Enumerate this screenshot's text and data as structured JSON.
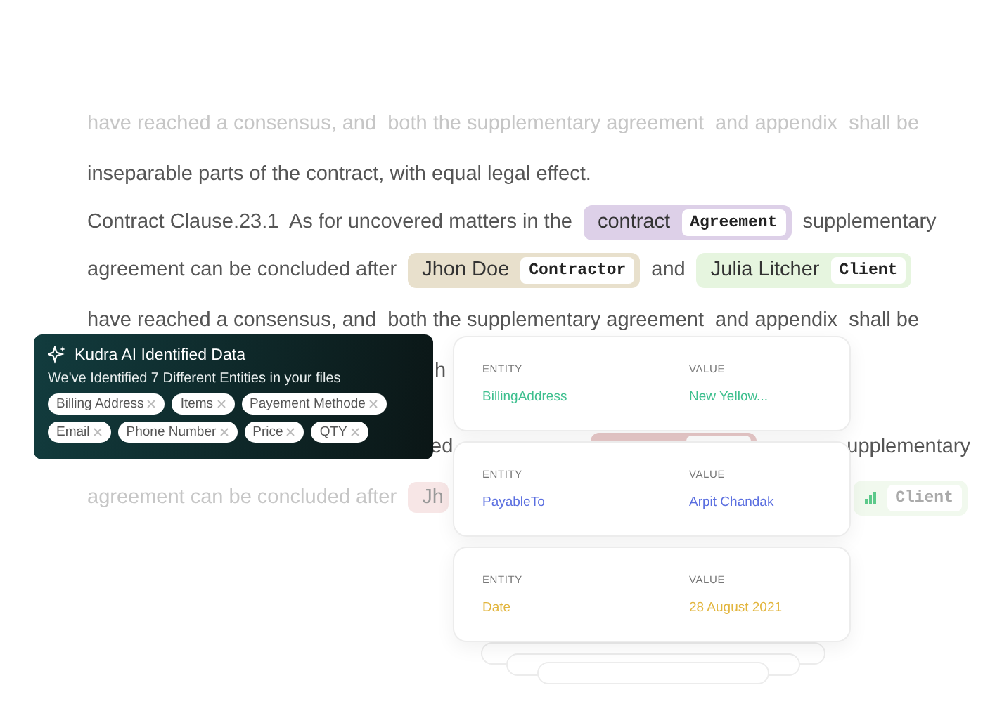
{
  "document": {
    "lines": [
      {
        "faded": true,
        "segments": [
          {
            "kind": "text",
            "text": "have reached a consensus, and"
          },
          {
            "kind": "text",
            "text": "both the supplementary agreement"
          },
          {
            "kind": "text",
            "text": "and appendix"
          },
          {
            "kind": "text",
            "text": "shall be"
          }
        ]
      },
      {
        "faded": false,
        "segments": [
          {
            "kind": "text",
            "text": "inseparable parts of the contract, with equal legal effect."
          }
        ]
      },
      {
        "faded": false,
        "segments": [
          {
            "kind": "text",
            "text": "Contract Clause.23.1  As for uncovered matters in the"
          },
          {
            "kind": "tag",
            "label": "contract",
            "chip": "Agreement",
            "color": "#ddd0e8"
          },
          {
            "kind": "text",
            "text": "supplementary"
          }
        ]
      },
      {
        "faded": false,
        "segments": [
          {
            "kind": "text",
            "text": "agreement can be concluded after"
          },
          {
            "kind": "tag",
            "label": "Jhon Doe",
            "chip": "Contractor",
            "color": "#e8e0cc"
          },
          {
            "kind": "text",
            "text": "and"
          },
          {
            "kind": "tag",
            "label": "Julia Litcher",
            "chip": "Client",
            "color": "#e6f5df"
          }
        ]
      },
      {
        "faded": false,
        "segments": [
          {
            "kind": "text",
            "text": "have reached a consensus, and"
          },
          {
            "kind": "text",
            "text": "both the supplementary agreement"
          },
          {
            "kind": "text",
            "text": "and appendix"
          },
          {
            "kind": "text",
            "text": "shall be"
          }
        ]
      },
      {
        "faded": false,
        "segments": [
          {
            "kind": "text",
            "text": "h"
          }
        ]
      },
      {
        "faded": false,
        "segments": [
          {
            "kind": "text",
            "text": "ed"
          },
          {
            "kind": "tag",
            "color": "#e8c9c9"
          },
          {
            "kind": "text",
            "text": "upplementary"
          }
        ]
      },
      {
        "faded": true,
        "segments": [
          {
            "kind": "text",
            "text": "agreement can be concluded after"
          },
          {
            "kind": "tag",
            "label": "Jh",
            "color": "#f7e6e6"
          },
          {
            "kind": "chart_tag",
            "chip": "Client",
            "color": "#f1f9ee"
          }
        ]
      }
    ]
  },
  "popup": {
    "title": "Kudra AI Identified Data",
    "subtitle": "We've Identified 7 Different Entities in your files",
    "chips": [
      "Billing Address",
      "Items",
      "Payement Methode",
      "Email",
      "Phone Number",
      "Price",
      "QTY"
    ]
  },
  "cards": [
    {
      "entity_label": "ENTITY",
      "value_label": "VALUE",
      "entity": "BillingAddress",
      "value": "New Yellow...",
      "color": "#3dbf8e"
    },
    {
      "entity_label": "ENTITY",
      "value_label": "VALUE",
      "entity": "PayableTo",
      "value": "Arpit Chandak",
      "color": "#5b6fe0"
    },
    {
      "entity_label": "ENTITY",
      "value_label": "VALUE",
      "entity": "Date",
      "value": "28 August 2021",
      "color": "#e2b53d"
    }
  ]
}
